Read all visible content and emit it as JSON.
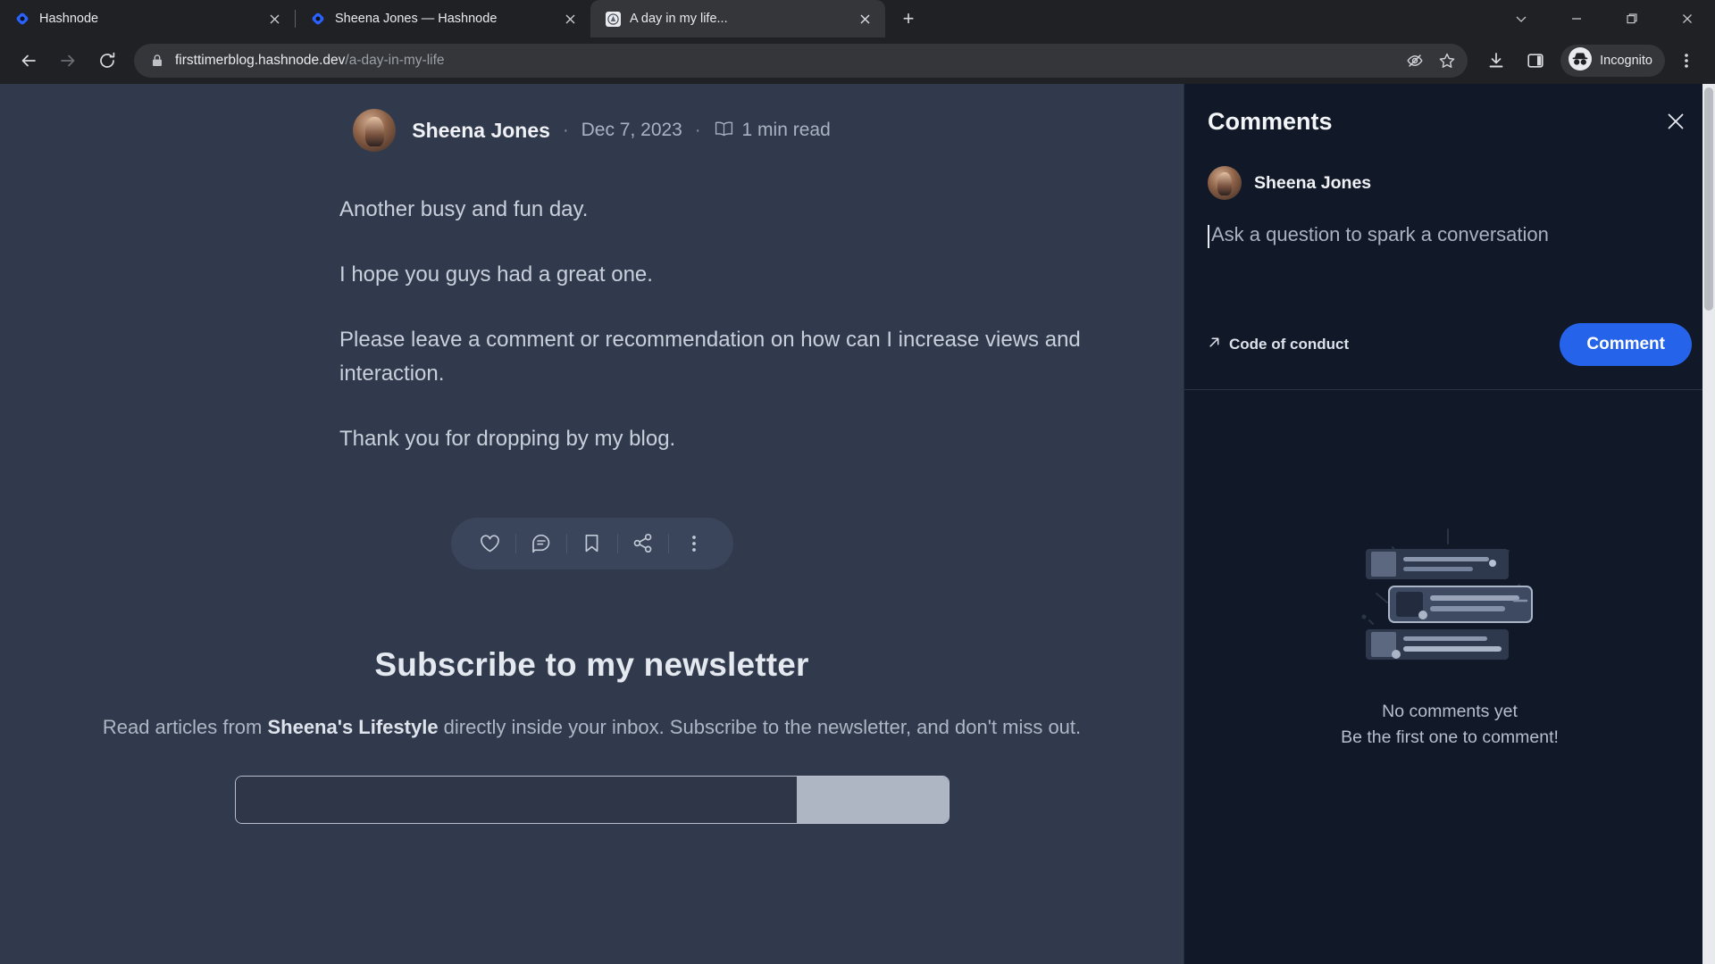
{
  "browser": {
    "tabs": [
      {
        "title": "Hashnode",
        "favicon": "hashnode-diamond-icon",
        "active": false
      },
      {
        "title": "Sheena Jones — Hashnode",
        "favicon": "hashnode-diamond-icon",
        "active": false
      },
      {
        "title": "A day in my life...",
        "favicon": "site-avatar-icon",
        "active": true
      }
    ],
    "new_tab_label": "+",
    "window_controls": {
      "tab_search": "tab-search-chevron",
      "minimize": "minimize",
      "maximize": "maximize",
      "close": "close"
    },
    "toolbar": {
      "back": "back-arrow",
      "forward": "forward-arrow",
      "reload": "reload",
      "url_domain": "firsttimerblog.hashnode.dev",
      "url_path": "/a-day-in-my-life",
      "lock_icon": "site-info-lock-icon",
      "eye_icon": "tracking-protection-icon",
      "bookmark_icon": "bookmark-star-icon",
      "download_icon": "downloads-icon",
      "sidepanel_icon": "side-panel-icon",
      "profile_label": "Incognito",
      "menu_icon": "three-dot-menu-icon"
    }
  },
  "article": {
    "author": "Sheena Jones",
    "separator": "·",
    "date": "Dec 7, 2023",
    "read_time": "1 min read",
    "read_icon": "open-book-icon",
    "paragraphs": [
      "Another busy and fun day.",
      "I hope you guys had a great one.",
      "Please leave a comment or recommendation on how can I increase views and interaction.",
      "Thank you for dropping by my blog."
    ],
    "actions": [
      {
        "name": "like-heart-icon",
        "label": "Like"
      },
      {
        "name": "comment-bubble-icon",
        "label": "Comment"
      },
      {
        "name": "bookmark-icon",
        "label": "Bookmark"
      },
      {
        "name": "share-icon",
        "label": "Share"
      },
      {
        "name": "more-options-icon",
        "label": "More"
      }
    ]
  },
  "newsletter": {
    "heading": "Subscribe to my newsletter",
    "desc_before": "Read articles from ",
    "desc_bold": "Sheena's Lifestyle",
    "desc_after": " directly inside your inbox. Subscribe to the newsletter, and don't miss out.",
    "email_placeholder": "",
    "subscribe_label": ""
  },
  "comments": {
    "title": "Comments",
    "close_icon": "close-icon",
    "composer": {
      "user": "Sheena Jones",
      "placeholder": "Ask a question to spark a conversation",
      "value": "",
      "code_of_conduct": "Code of conduct",
      "code_of_conduct_icon": "external-link-arrow-icon",
      "submit_label": "Comment",
      "submit_color": "#2563eb"
    },
    "empty_state": {
      "line1": "No comments yet",
      "line2": "Be the first one to comment!",
      "illustration": "empty-comments-illustration"
    }
  }
}
